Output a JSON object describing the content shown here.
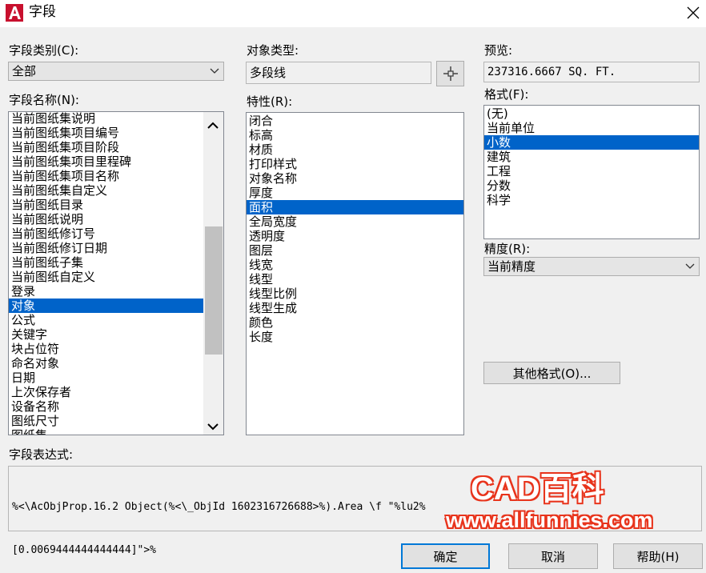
{
  "window": {
    "title": "字段"
  },
  "field_category": {
    "label": "字段类别(C):",
    "value": "全部"
  },
  "field_names": {
    "label": "字段名称(N):",
    "items": [
      "当前图纸集说明",
      "当前图纸集项目编号",
      "当前图纸集项目阶段",
      "当前图纸集项目里程碑",
      "当前图纸集项目名称",
      "当前图纸集自定义",
      "当前图纸目录",
      "当前图纸说明",
      "当前图纸修订号",
      "当前图纸修订日期",
      "当前图纸子集",
      "当前图纸自定义",
      "登录",
      "对象",
      "公式",
      "关键字",
      "块占位符",
      "命名对象",
      "日期",
      "上次保存者",
      "设备名称",
      "图纸尺寸",
      "图纸集"
    ],
    "selected": "对象"
  },
  "object_type": {
    "label": "对象类型:",
    "value": "多段线"
  },
  "properties": {
    "label": "特性(R):",
    "items": [
      "闭合",
      "标高",
      "材质",
      "打印样式",
      "对象名称",
      "厚度",
      "面积",
      "全局宽度",
      "透明度",
      "图层",
      "线宽",
      "线型",
      "线型比例",
      "线型生成",
      "颜色",
      "长度"
    ],
    "selected": "面积"
  },
  "preview": {
    "label": "预览:",
    "value": "237316.6667 SQ. FT."
  },
  "format": {
    "label": "格式(F):",
    "items": [
      "(无)",
      "当前单位",
      "小数",
      "建筑",
      "工程",
      "分数",
      "科学"
    ],
    "selected": "小数"
  },
  "precision": {
    "label": "精度(R):",
    "value": "当前精度"
  },
  "other_format": {
    "label": "其他格式(O)..."
  },
  "expression": {
    "label": "字段表达式:",
    "value": "%<\\AcObjProp.16.2 Object(%<\\_ObjId 1602316726688>%).Area \\f \"%lu2%",
    "value2": "[0.0069444444444444]\">%"
  },
  "buttons": {
    "ok": "确定",
    "cancel": "取消",
    "help": "帮助(H)"
  },
  "watermark": {
    "title": "CAD百科",
    "url": "www.allfunnies.com"
  }
}
